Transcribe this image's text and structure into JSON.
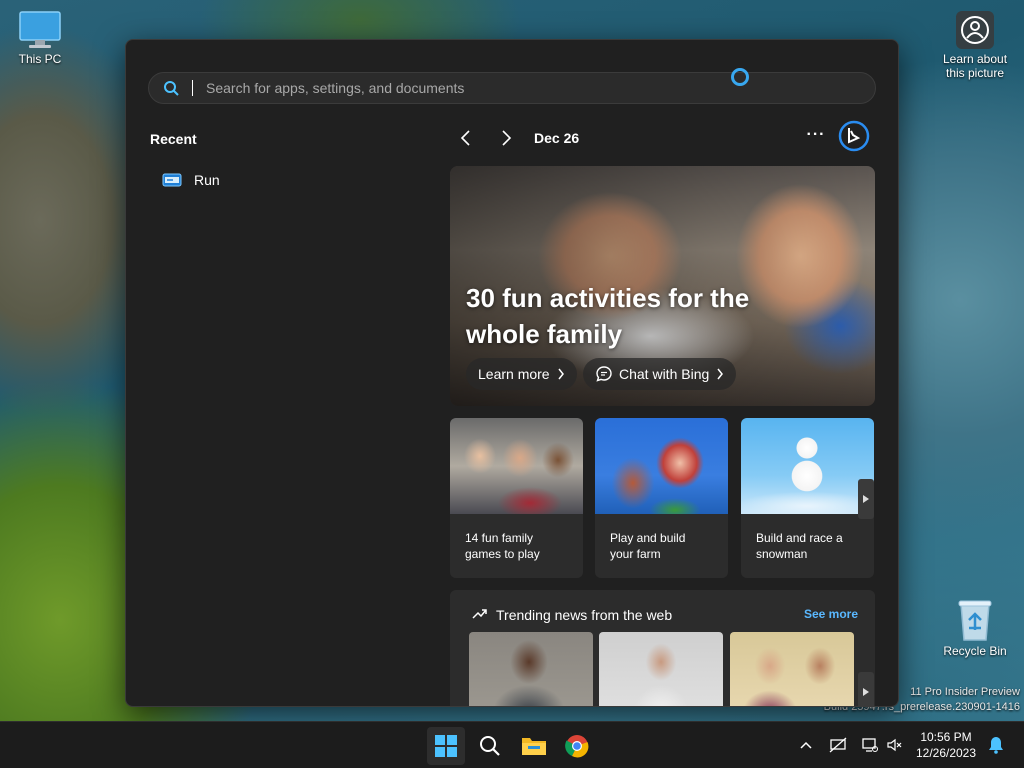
{
  "desktop": {
    "this_pc_label": "This PC",
    "learn_label_line1": "Learn about",
    "learn_label_line2": "this picture",
    "recycle_label": "Recycle Bin",
    "watermark_line1": "11 Pro Insider Preview",
    "watermark_line2": "Build 25947.rs_prerelease.230901-1416"
  },
  "search": {
    "placeholder": "Search for apps, settings, and documents"
  },
  "recent": {
    "title": "Recent",
    "items": [
      {
        "label": "Run",
        "icon": "run-icon"
      }
    ]
  },
  "feed": {
    "date": "Dec 26",
    "more_label": "···",
    "hero": {
      "title": "30 fun activities for the whole family",
      "learn_more_label": "Learn more",
      "chat_bing_label": "Chat with Bing"
    },
    "cards": [
      {
        "line1": "14 fun family",
        "line2": "games to play"
      },
      {
        "line1": "Play and build",
        "line2": "your farm"
      },
      {
        "line1": "Build and race a",
        "line2": "snowman"
      }
    ],
    "trending": {
      "title": "Trending news from the web",
      "see_more_label": "See more"
    }
  },
  "taskbar": {
    "time": "10:56 PM",
    "date": "12/26/2023"
  },
  "colors": {
    "accent": "#38a8f0",
    "link": "#5ab8ff",
    "panel_bg": "#202020"
  }
}
